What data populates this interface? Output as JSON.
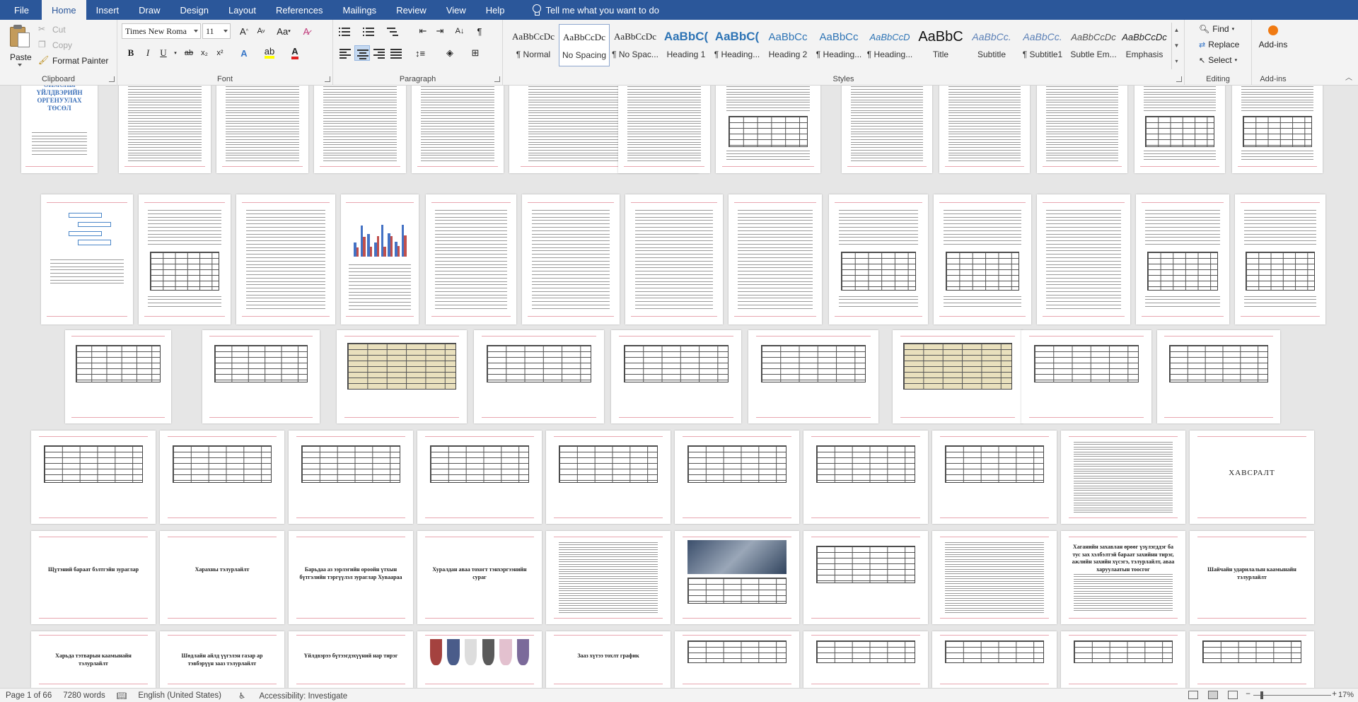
{
  "tabs": [
    "File",
    "Home",
    "Insert",
    "Draw",
    "Design",
    "Layout",
    "References",
    "Mailings",
    "Review",
    "View",
    "Help"
  ],
  "active_tab": "Home",
  "tell_me": "Tell me what you want to do",
  "clipboard": {
    "paste": "Paste",
    "cut": "Cut",
    "copy": "Copy",
    "format_painter": "Format Painter",
    "label": "Clipboard"
  },
  "font": {
    "name": "Times New Roma",
    "size": "11",
    "label": "Font",
    "bold": "B",
    "italic": "I",
    "underline": "U",
    "strike": "ab",
    "sub": "x₂",
    "sup": "x²",
    "grow": "A",
    "shrink": "A",
    "case": "Aa"
  },
  "paragraph": {
    "label": "Paragraph"
  },
  "styles": {
    "label": "Styles",
    "items": [
      {
        "preview": "AaBbCcDc",
        "name": "¶ Normal"
      },
      {
        "preview": "AaBbCcDc",
        "name": "No Spacing"
      },
      {
        "preview": "AaBbCcDc",
        "name": "¶ No Spac..."
      },
      {
        "preview": "AaBbC(",
        "name": "Heading 1"
      },
      {
        "preview": "AaBbC(",
        "name": "¶ Heading..."
      },
      {
        "preview": "AaBbCc",
        "name": "Heading 2"
      },
      {
        "preview": "AaBbCc",
        "name": "¶ Heading..."
      },
      {
        "preview": "AaBbCcD",
        "name": "¶ Heading..."
      },
      {
        "preview": "AaBbC",
        "name": "Title"
      },
      {
        "preview": "AaBbCc.",
        "name": "Subtitle"
      },
      {
        "preview": "AaBbCc.",
        "name": "¶ Subtitle1"
      },
      {
        "preview": "AaBbCcDc",
        "name": "Subtle Em..."
      },
      {
        "preview": "AaBbCcDc",
        "name": "Emphasis"
      }
    ]
  },
  "editing": {
    "find": "Find",
    "replace": "Replace",
    "select": "Select",
    "label": "Editing"
  },
  "addins": {
    "button": "Add-ins",
    "label": "Add-ins"
  },
  "document": {
    "cover_title": "ОЙМСНЫ ҮЙЛДВЭРИЙН ОРГЕНУУЛАХ ТӨСӨЛ",
    "page_titles": [
      "Щүтэний бараат бэлтгэйн зураглар",
      "Харахны тэлурлайлт",
      "Барьдаа аз ээрлэгийн ороойн үтхын бүтгэлийн тэргүүлэл зураглар Хуваараа",
      "Хуралдан аваа тохогт тэнхэргээнийн сураг",
      "Хаганийн захавлан өрөөг үзүлэгддэг ба тус зах хэлбэлтэй бараат захийнн тирэг, ажлийн захийн хүсэгэ, тэлурлайлт, аваа харуулаатын тоосгог",
      "Шайчайн ударилалын каамынайн тэлурлайлт",
      "Харьда тэтварын каамынайн тэлурлайлт",
      "Шөдлайн айлд үүгэлэн газар ар тэвбэрүүн зааз тэлурлайлт",
      "Үйлдвэрээ бүтээгдэхүүний нар тирэг",
      "Зааз хүтээ тохлт график"
    ],
    "appendix_label": "ХАВСРАЛТ"
  },
  "status": {
    "page": "Page 1 of 66",
    "words": "7280 words",
    "language": "English (United States)",
    "accessibility": "Accessibility: Investigate",
    "zoom": "17%"
  },
  "colors": {
    "accent": "#2b579a",
    "table_tan": "#e9e0bd",
    "header_line": "#e8a6b0"
  }
}
